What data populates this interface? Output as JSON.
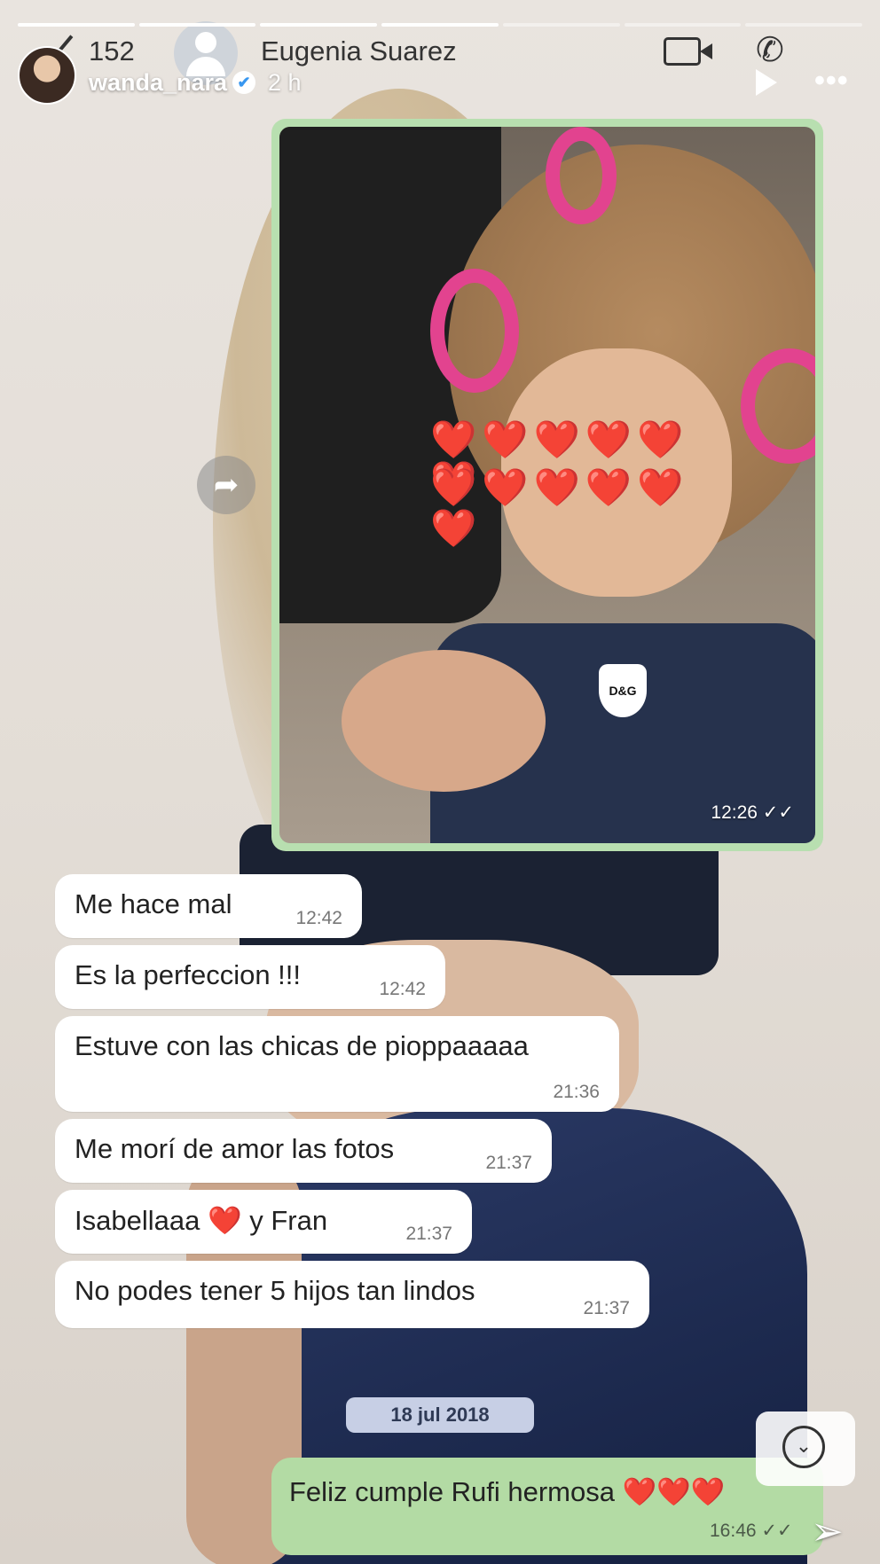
{
  "story": {
    "username": "wanda_nara",
    "time_ago": "2 h",
    "verified_mark": "✔"
  },
  "chat": {
    "unread_count": "152",
    "contact_name": "Eugenia Suarez",
    "image_message": {
      "hearts_row_1": "❤️❤️❤️❤️❤️❤️",
      "hearts_row_2": "❤️❤️❤️❤️❤️❤️",
      "logo_text": "D&G",
      "time": "12:26 ✓✓"
    },
    "received": [
      {
        "text": "Me hace mal",
        "time": "12:42"
      },
      {
        "text": "Es la perfeccion !!!",
        "time": "12:42"
      },
      {
        "text": "Estuve con las chicas de pioppaaaaa",
        "time": "21:36"
      },
      {
        "text": "Me morí de amor las fotos",
        "time": "21:37"
      },
      {
        "text_before": "Isabellaaa",
        "heart": "❤️",
        "text_after": "y Fran",
        "time": "21:37"
      },
      {
        "text": "No podes tener 5 hijos tan lindos",
        "time": "21:37"
      }
    ],
    "date_separator": "18 jul 2018",
    "sent": {
      "text": "Feliz cumple Rufi hermosa ❤️❤️❤️",
      "time": "16:46 ✓✓"
    }
  },
  "icons": [
    "back-icon",
    "contact-photo-icon",
    "video-call-icon",
    "phone-call-icon",
    "verified-icon",
    "play-icon",
    "more-icon",
    "share-icon",
    "scroll-down-icon",
    "send-icon"
  ],
  "colors": {
    "sent_bubble": "#b3dba4",
    "received_bubble": "#ffffff",
    "date_pill": "#c7cfe5",
    "heart": "#d90f1a",
    "curler": "#e2438f"
  }
}
